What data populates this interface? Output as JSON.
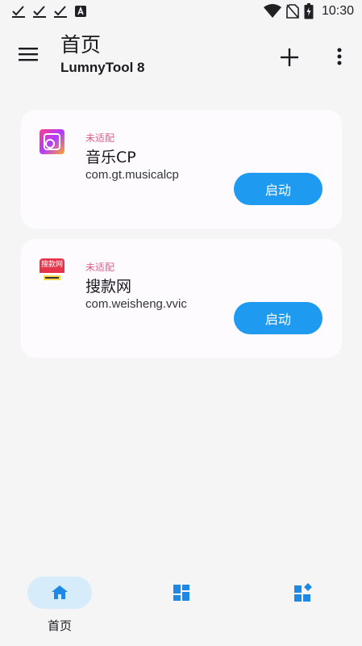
{
  "status_bar": {
    "time": "10:30",
    "left_icons": [
      "check-icon",
      "check-icon",
      "check-icon",
      "a-letter-icon"
    ],
    "right_icons": [
      "wifi-icon",
      "no-sim-icon",
      "battery-icon"
    ]
  },
  "header": {
    "title": "首页",
    "subtitle": "LumnyTool 8",
    "menu_icon": "menu-icon",
    "add_icon": "plus-icon",
    "more_icon": "more-vert-icon"
  },
  "apps": [
    {
      "status": "未适配",
      "name": "音乐CP",
      "package": "com.gt.musicalcp",
      "launch_label": "启动",
      "icon": "music-app-icon"
    },
    {
      "status": "未适配",
      "name": "搜款网",
      "package": "com.weisheng.vvic",
      "launch_label": "启动",
      "icon": "soukuan-app-icon",
      "icon_text": "搜款网"
    }
  ],
  "bottom_nav": {
    "items": [
      {
        "label": "首页",
        "icon": "home-icon",
        "selected": true
      },
      {
        "label": "",
        "icon": "dashboard-icon",
        "selected": false
      },
      {
        "label": "",
        "icon": "widgets-icon",
        "selected": false
      }
    ]
  },
  "colors": {
    "accent": "#1e9bf0",
    "status_pink": "#e05f8a",
    "card_bg": "#fdfbfe",
    "nav_pill": "#d7ecfb"
  }
}
